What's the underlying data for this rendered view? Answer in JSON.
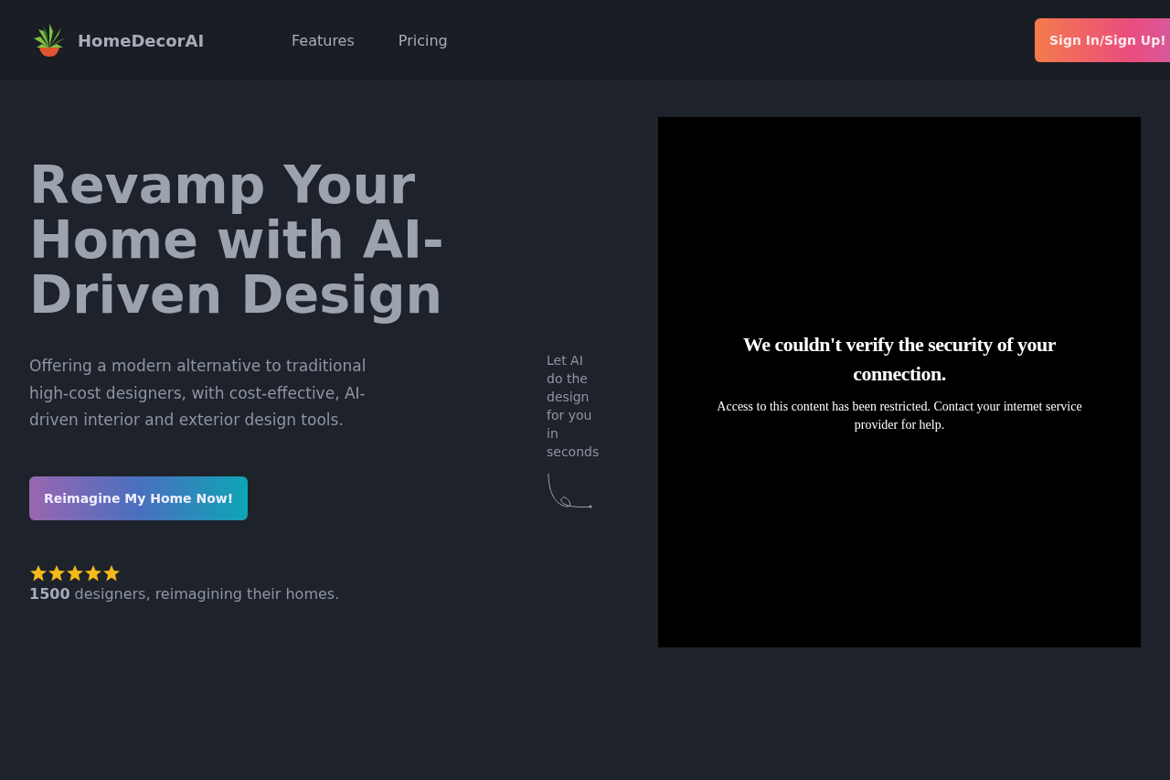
{
  "header": {
    "brand": "HomeDecorAI",
    "nav": [
      {
        "label": "Features"
      },
      {
        "label": "Pricing"
      }
    ],
    "sign_in_button": "Sign In/Sign Up!"
  },
  "hero": {
    "title": "Revamp Your Home with AI-Driven Design",
    "description": "Offering a modern alternative to traditional high-cost designers, with cost-effective, AI-driven interior and exterior design tools.",
    "cta_button": "Reimagine My Home Now!",
    "rating": {
      "stars": 5,
      "text": "**1500** designers, reimagining their homes."
    },
    "annotation": "Let AI do the design for you in seconds",
    "video_panel": {
      "heading": "We couldn't verify the security of your connection.",
      "message": "Access to this content has been restricted. Contact your internet service provider for help."
    }
  }
}
